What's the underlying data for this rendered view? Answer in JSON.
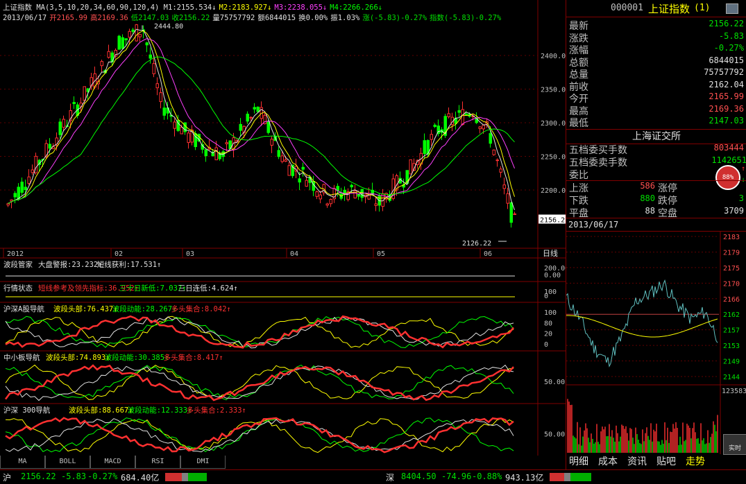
{
  "main_chart": {
    "title": "上证指数",
    "ma_label": "MA(3,5,10,20,34,60,90,120,4)",
    "ma_values": [
      {
        "label": "M1:2155.534",
        "color": "#e0e0e0"
      },
      {
        "label": "M2:2183.927",
        "color": "#ffff00"
      },
      {
        "label": "M3:2238.055",
        "color": "#ff40ff"
      },
      {
        "label": "M4:2266.266",
        "color": "#00ff00"
      }
    ],
    "ohlc_line": [
      {
        "t": "2013/06/17",
        "c": "#e0e0e0"
      },
      {
        "t": "开2165.99",
        "c": "#ff5050"
      },
      {
        "t": "高2169.36",
        "c": "#ff5050"
      },
      {
        "t": "低2147.03",
        "c": "#00e000"
      },
      {
        "t": "收2156.22",
        "c": "#00e000"
      },
      {
        "t": "量75757792",
        "c": "#e0e0e0"
      },
      {
        "t": "额6844015",
        "c": "#e0e0e0"
      },
      {
        "t": "换0.00%",
        "c": "#e0e0e0"
      },
      {
        "t": "振1.03%",
        "c": "#e0e0e0"
      },
      {
        "t": "涨(-5.83)-0.27%",
        "c": "#00e000"
      },
      {
        "t": "指数(-5.83)-0.27%",
        "c": "#00e000"
      }
    ],
    "y_ticks": [
      "2400.0",
      "2350.0",
      "2300.0",
      "2250.0",
      "2200.0"
    ],
    "x_ticks": [
      "2012",
      "02",
      "03",
      "04",
      "05",
      "06"
    ],
    "high_label": "2444.80",
    "low_label": "2126.22",
    "price_tag": "2156.2",
    "period": "日线"
  },
  "indicators": [
    {
      "name": "波段管家",
      "parts": [
        {
          "t": "大盘警报:23.232",
          "c": "#e0e0e0"
        },
        {
          "t": "短线获利:17.531",
          "c": "#e0e0e0"
        }
      ],
      "ticks": [
        "200.00",
        "0.00"
      ]
    },
    {
      "name": "行情状态",
      "parts": [
        {
          "t": "短线参考及领先指标:36.952",
          "c": "#ff3030"
        },
        {
          "t": "三十日新低:7.037",
          "c": "#00ff00"
        },
        {
          "t": "三日连低:4.624",
          "c": "#e0e0e0"
        }
      ],
      "ticks": [
        "100",
        "0"
      ]
    },
    {
      "name": "沪深A股导航",
      "parts": [
        {
          "t": "波段头部:76.437",
          "c": "#ffff00"
        },
        {
          "t": "波段动能:28.267",
          "c": "#00ff00"
        },
        {
          "t": "多头集合:8.042",
          "c": "#ff3030"
        }
      ],
      "ticks": [
        "100",
        "80",
        "20",
        "0"
      ]
    },
    {
      "name": "中小板导航",
      "parts": [
        {
          "t": "波段头部:74.893",
          "c": "#ffff00"
        },
        {
          "t": "波段动能:30.385",
          "c": "#00ff00"
        },
        {
          "t": "多头集合:8.417",
          "c": "#ff3030"
        }
      ],
      "ticks": [
        "50.00"
      ]
    },
    {
      "name": "沪深 300导航",
      "parts": [
        {
          "t": "波段头部:88.667",
          "c": "#ffff00"
        },
        {
          "t": "波段动能:12.333",
          "c": "#00ff00"
        },
        {
          "t": "多头集合:2.333",
          "c": "#ff3030"
        }
      ],
      "ticks": [
        "50.00"
      ]
    }
  ],
  "bottom_tabs": [
    "MA",
    "BOLL",
    "MACD",
    "RSI",
    "DMI"
  ],
  "quote": {
    "code": "000001",
    "name": "上证指数",
    "suffix": "(1)",
    "rows": [
      {
        "label": "最新",
        "value": "2156.22",
        "cls": "dn"
      },
      {
        "label": "涨跌",
        "value": "-5.83",
        "cls": "dn"
      },
      {
        "label": "涨幅",
        "value": "-0.27%",
        "cls": "dn"
      },
      {
        "label": "总额",
        "value": "6844015",
        "cls": "wh"
      },
      {
        "label": "总量",
        "value": "75757792",
        "cls": "wh"
      },
      {
        "label": "前收",
        "value": "2162.04",
        "cls": "wh"
      },
      {
        "label": "今开",
        "value": "2165.99",
        "cls": "up"
      },
      {
        "label": "最高",
        "value": "2169.36",
        "cls": "up"
      },
      {
        "label": "最低",
        "value": "2147.03",
        "cls": "dn"
      }
    ],
    "exchange": "上海证交所",
    "buy_label": "五档委买手数",
    "buy_value": "803444",
    "sell_label": "五档委卖手数",
    "sell_value": "1142651",
    "ratio_label": "委比",
    "ratio_badge": "88%",
    "up_label": "上涨",
    "up_value": "586",
    "limit_up_label": "涨停",
    "limit_up_value": "",
    "down_label": "下跌",
    "down_value": "880",
    "limit_down_label": "跌停",
    "limit_down_value": "3",
    "flat_label": "平盘",
    "flat_value": "88",
    "idle_label": "空盘",
    "idle_value": "3709",
    "date": "2013/06/17"
  },
  "intraday": {
    "y_ticks": [
      "2183",
      "2179",
      "2175",
      "2170",
      "2166",
      "2162",
      "2157",
      "2153",
      "2149",
      "2144"
    ],
    "vol_tick": "123583",
    "realtime_label": "实时"
  },
  "right_tabs": [
    "明细",
    "成本",
    "资讯",
    "贴吧",
    "走势"
  ],
  "status_bar": {
    "sh_label": "沪",
    "sh_price": "2156.22",
    "sh_change": "-5.83",
    "sh_pct": "-0.27%",
    "sh_amount": "684.40亿",
    "sz_label": "深",
    "sz_price": "8404.50",
    "sz_change": "-74.96",
    "sz_pct": "-0.88%",
    "sz_amount": "943.13亿"
  },
  "colors": {
    "up": "#ff3030",
    "down": "#00e000",
    "ma1": "#e0e0e0",
    "ma2": "#ffff00",
    "ma3": "#ff40ff",
    "ma4": "#00ff00",
    "grid": "#800000"
  }
}
